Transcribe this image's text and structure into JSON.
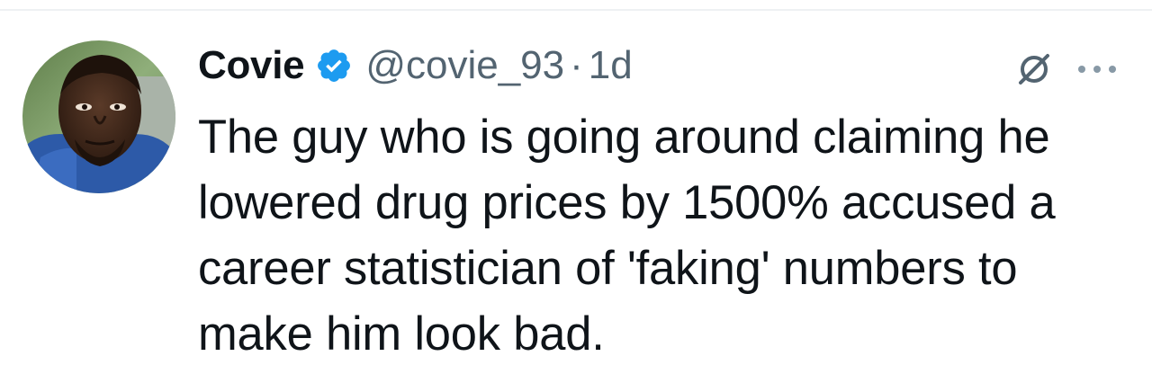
{
  "tweet": {
    "author": {
      "display_name": "Covie",
      "handle": "@covie_93",
      "verified": true,
      "verified_icon": "verified-badge-icon",
      "avatar_icon": "user-avatar"
    },
    "time_separator": "·",
    "timestamp": "1d",
    "actions": {
      "block_icon": "block-icon",
      "more_icon": "more-options-icon"
    },
    "text_lines": [
      "The guy who is going around claiming he",
      "lowered drug prices by 1500% accused a",
      "career statistician of 'faking' numbers to",
      "make him look bad."
    ]
  },
  "colors": {
    "text_primary": "#0f1419",
    "text_secondary": "#536471",
    "verified_blue": "#1d9bf0",
    "divider": "#eef1f3"
  }
}
